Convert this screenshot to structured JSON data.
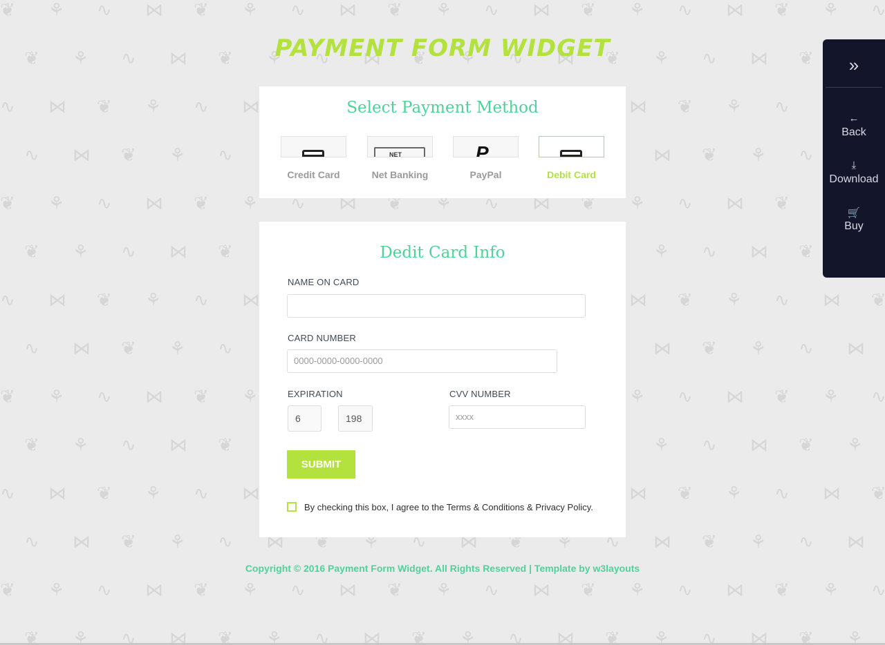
{
  "page": {
    "title": "PAYMENT FORM WIDGET"
  },
  "methods_card": {
    "heading": "Select Payment Method",
    "items": [
      {
        "label": "Credit Card",
        "icon": "credit-card-icon",
        "active": false
      },
      {
        "label": "Net Banking",
        "icon": "net-banking-icon",
        "thumb_text": "NET",
        "active": false
      },
      {
        "label": "PayPal",
        "icon": "paypal-icon",
        "thumb_text": "P",
        "active": false
      },
      {
        "label": "Debit Card",
        "icon": "debit-card-icon",
        "active": true
      }
    ]
  },
  "form_card": {
    "heading": "Dedit Card Info",
    "name_label": "NAME ON CARD",
    "name_value": "",
    "card_number_label": "CARD NUMBER",
    "card_number_placeholder": "0000-0000-0000-0000",
    "expiration_label": "EXPIRATION",
    "exp_month": "6",
    "exp_year": "198",
    "cvv_label": "CVV NUMBER",
    "cvv_placeholder": "xxxx",
    "submit_label": "SUBMIT",
    "agree_text": "By checking this box, I agree to the Terms & Conditions & Privacy Policy."
  },
  "footer": {
    "text": "Copyright © 2016 Payment Form Widget. All Rights Reserved | Template by w3layouts"
  },
  "side_panel": {
    "toggle_icon": "»",
    "items": [
      {
        "icon": "←",
        "label": "Back"
      },
      {
        "icon": "⤓",
        "label": "Download"
      },
      {
        "icon": "🛒",
        "label": "Buy"
      }
    ]
  },
  "colors": {
    "accent_green": "#b3e23f",
    "heading_teal": "#4fd19a",
    "panel_dark": "#13152a",
    "background": "#ebebeb"
  }
}
